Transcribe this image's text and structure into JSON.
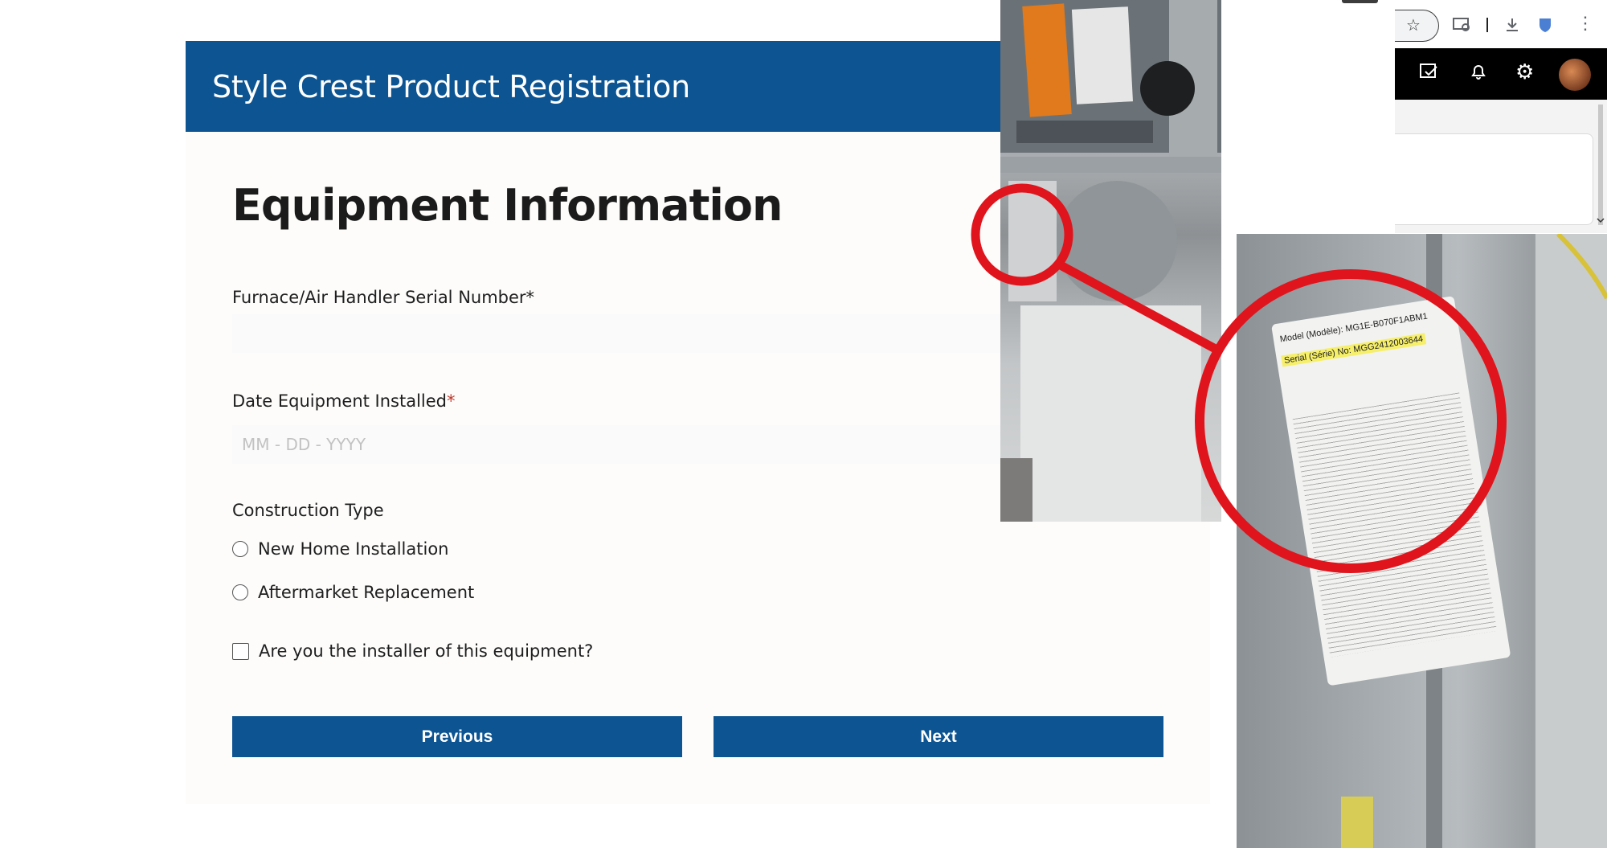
{
  "header": {
    "title": "Style Crest Product Registration"
  },
  "section": {
    "title": "Equipment Information"
  },
  "fields": {
    "serial": {
      "label": "Furnace/Air Handler Serial Number*",
      "value": ""
    },
    "date": {
      "label": "Date Equipment Installed",
      "required_mark": "*",
      "placeholder": "MM - DD - YYYY",
      "value": ""
    },
    "construction": {
      "label": "Construction Type",
      "options": [
        "New Home Installation",
        "Aftermarket Replacement"
      ],
      "selected": null
    },
    "installer": {
      "label": "Are you the installer of this equipment?",
      "checked": false
    }
  },
  "buttons": {
    "previous": "Previous",
    "next": "Next"
  },
  "browser": {
    "icons": [
      "star-icon",
      "screen-search-icon",
      "download-icon",
      "extension-icon",
      "more-vert-icon",
      "note-check-icon",
      "bell-icon",
      "gear-icon",
      "avatar"
    ]
  },
  "photo": {
    "plate_model": "Model (Modèle): MG1E-B070F1ABM1",
    "plate_serial": "Serial (Série) No: MGG2412003644"
  },
  "colors": {
    "brand_blue": "#0c5492",
    "highlight_circle": "#e0141c",
    "required": "#c0392b"
  }
}
